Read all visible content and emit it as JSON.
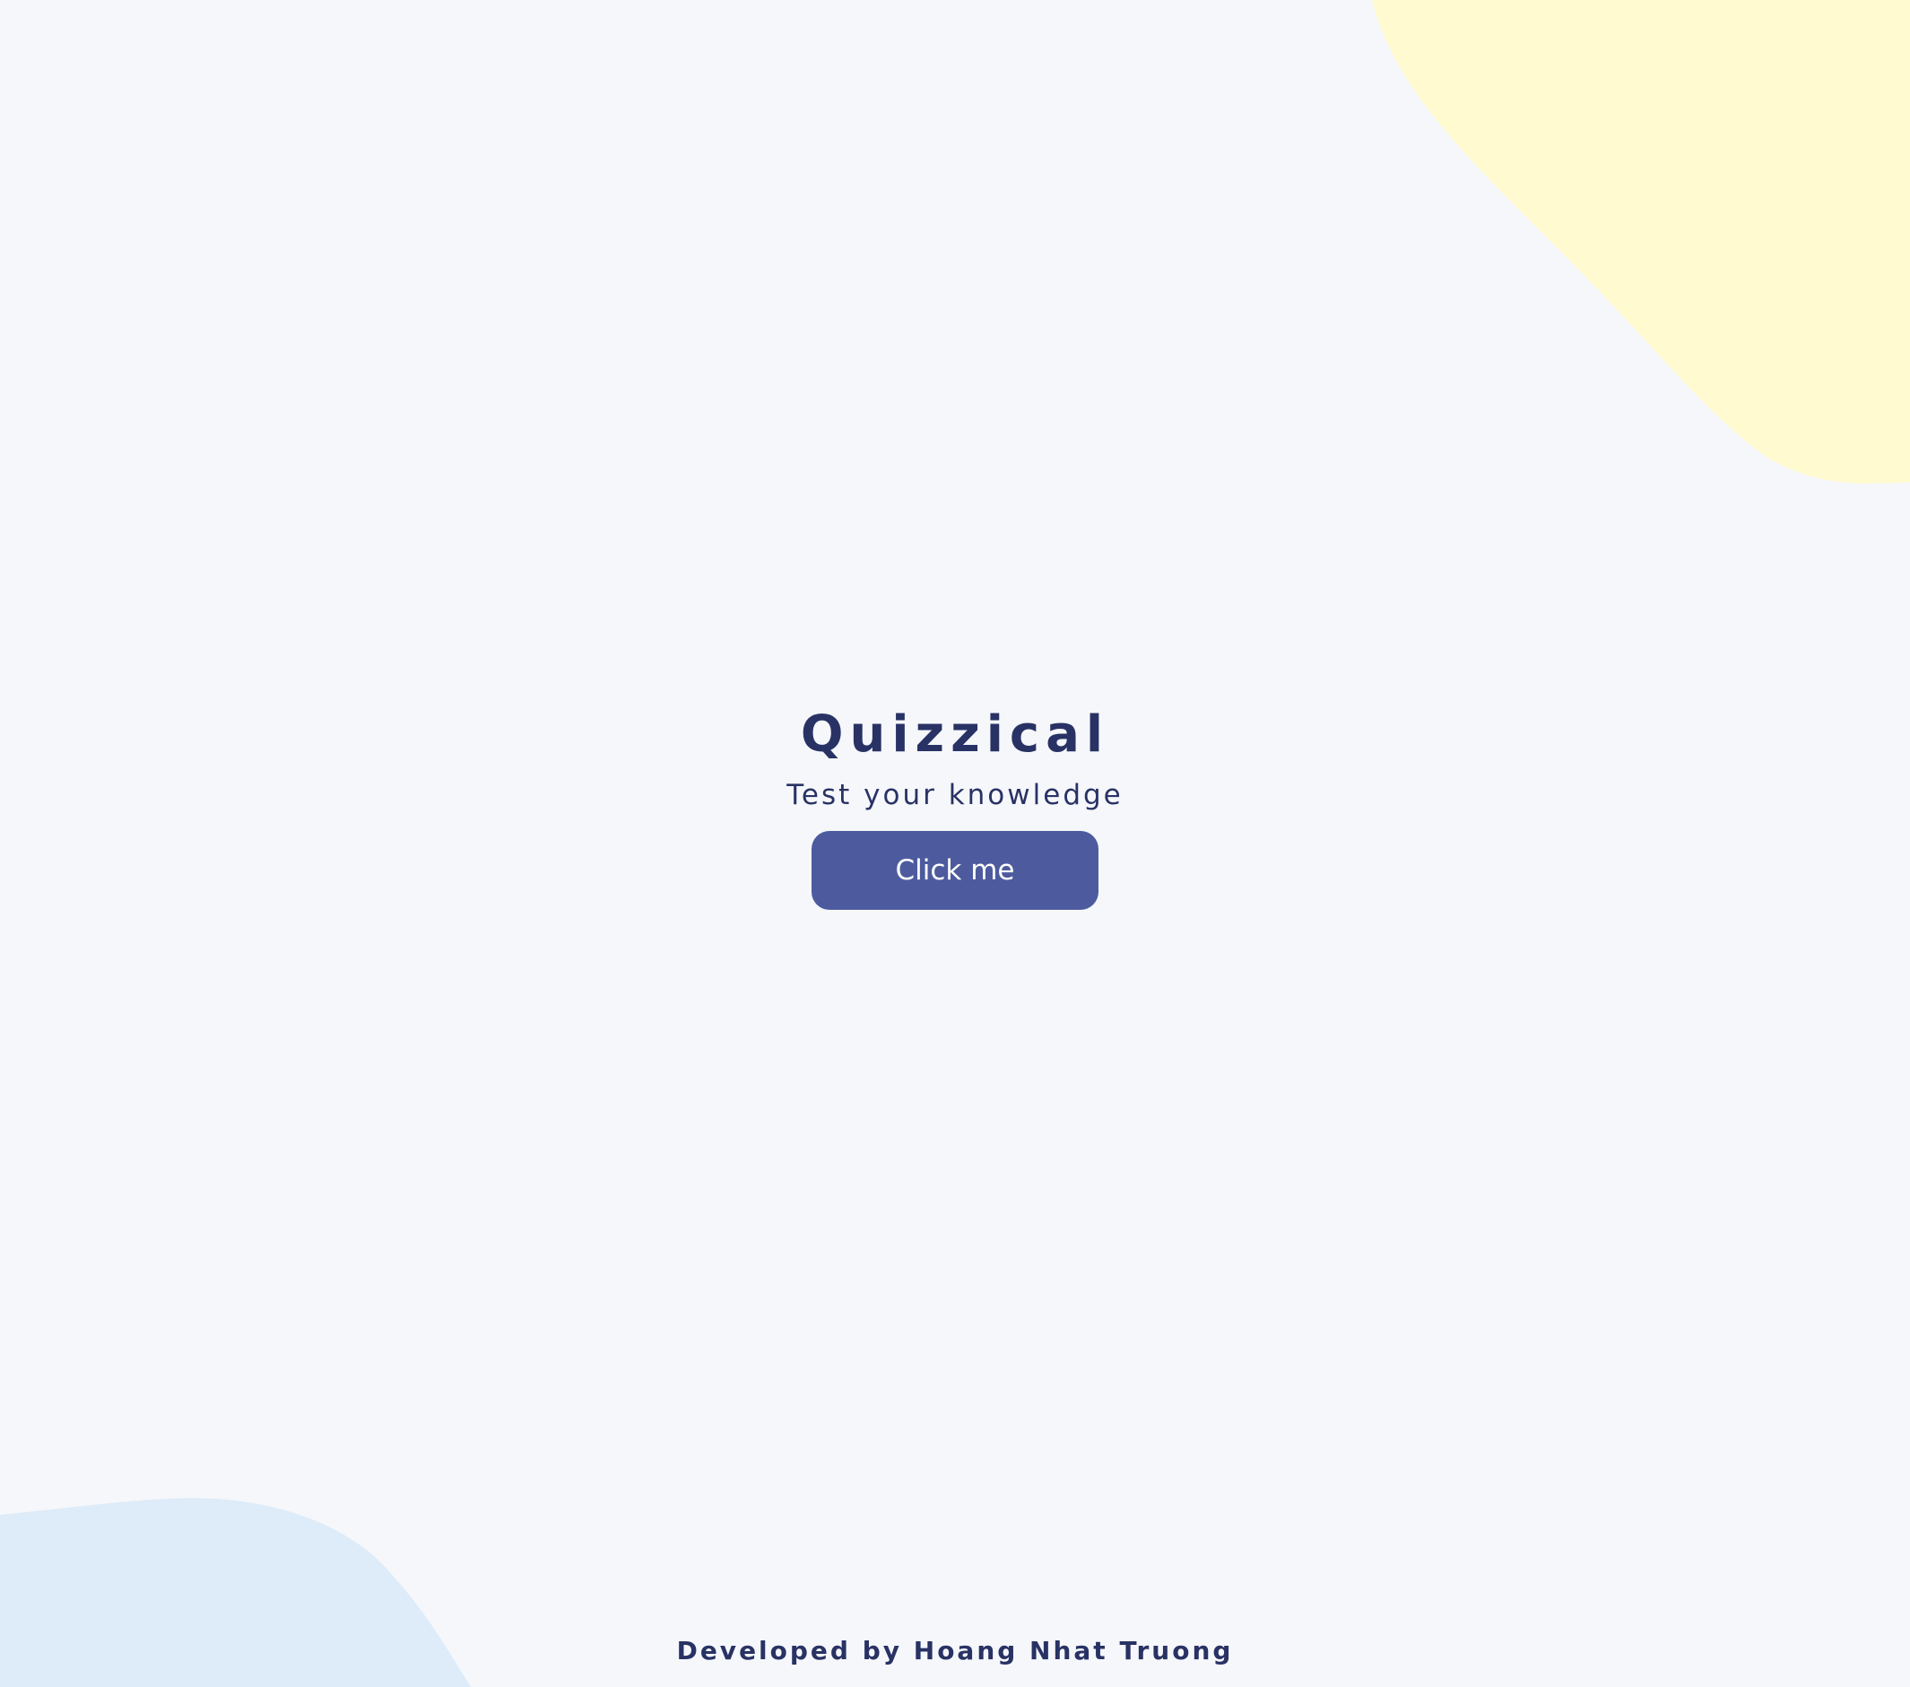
{
  "colors": {
    "background": "#F5F7FB",
    "text": "#293264",
    "button": "#4D5B9E",
    "button_text": "#FFFFFF",
    "blob_yellow": "#FFFACF",
    "blob_blue": "#DEEBF8"
  },
  "intro": {
    "title": "Quizzical",
    "subtitle": "Test your knowledge",
    "start_button_label": "Click me"
  },
  "footer": {
    "credit": "Developed by Hoang Nhat Truong"
  }
}
